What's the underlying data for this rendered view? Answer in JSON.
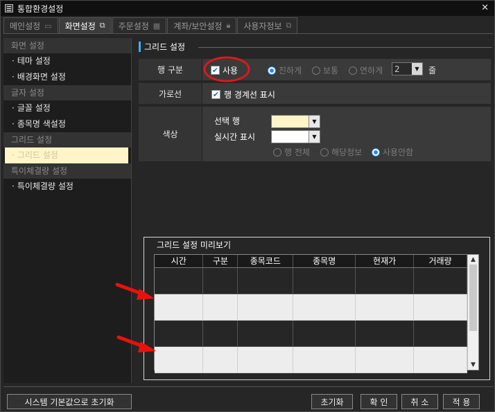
{
  "window": {
    "title": "통합환경설정",
    "close_glyph": "✕"
  },
  "tabs": [
    {
      "label": "메인설정",
      "icon": "monitor-icon"
    },
    {
      "label": "화면설정",
      "icon": "windows-icon"
    },
    {
      "label": "주문설정",
      "icon": "calculator-icon"
    },
    {
      "label": "계좌/보안설정",
      "icon": "lock-icon"
    },
    {
      "label": "사용자정보",
      "icon": "windows-icon"
    }
  ],
  "sidebar": {
    "groups": [
      {
        "header": "화면 설정",
        "items": [
          "테마 설정",
          "배경화면 설정"
        ]
      },
      {
        "header": "글자 설정",
        "items": [
          "글꼴 설정",
          "종목명 색설정"
        ]
      },
      {
        "header": "그리드 설정",
        "items": [
          "그리드 설정"
        ]
      },
      {
        "header": "특이체결량 설정",
        "items": [
          "특이체결량 설정"
        ]
      }
    ],
    "bullet": "·"
  },
  "section": {
    "title": "그리드 설정"
  },
  "row_division": {
    "label": "행 구분",
    "use_label": "사용",
    "use_checked": true,
    "options": [
      "진하게",
      "보통",
      "연하게"
    ],
    "lines_value": "2",
    "lines_unit": "줄"
  },
  "row_gridline": {
    "label": "가로선",
    "checkbox_label": "행 경계선 표시",
    "checked": true
  },
  "row_color": {
    "label": "색상",
    "selected_row_label": "선택 행",
    "realtime_label": "실시간 표시",
    "selected_row_color": "#fff4c8",
    "realtime_color": "#ffffff",
    "options": [
      "행 전체",
      "해당정보",
      "사용안함"
    ],
    "selected_option": "사용안함"
  },
  "preview": {
    "title": "그리드 설정 미리보기",
    "columns": [
      "시간",
      "구분",
      "종목코드",
      "종목명",
      "현재가",
      "거래량"
    ]
  },
  "colors": {
    "accent": "#3ab0ff",
    "highlight_circle": "#e01818",
    "arrow": "#e8120c",
    "selected_row": "#fff4c8",
    "stripe_light": "#ededed"
  },
  "buttons": {
    "reset_system": "시스템 기본값으로 초기화",
    "reset": "초기화",
    "ok": "확 인",
    "cancel": "취 소",
    "apply": "적 용"
  }
}
